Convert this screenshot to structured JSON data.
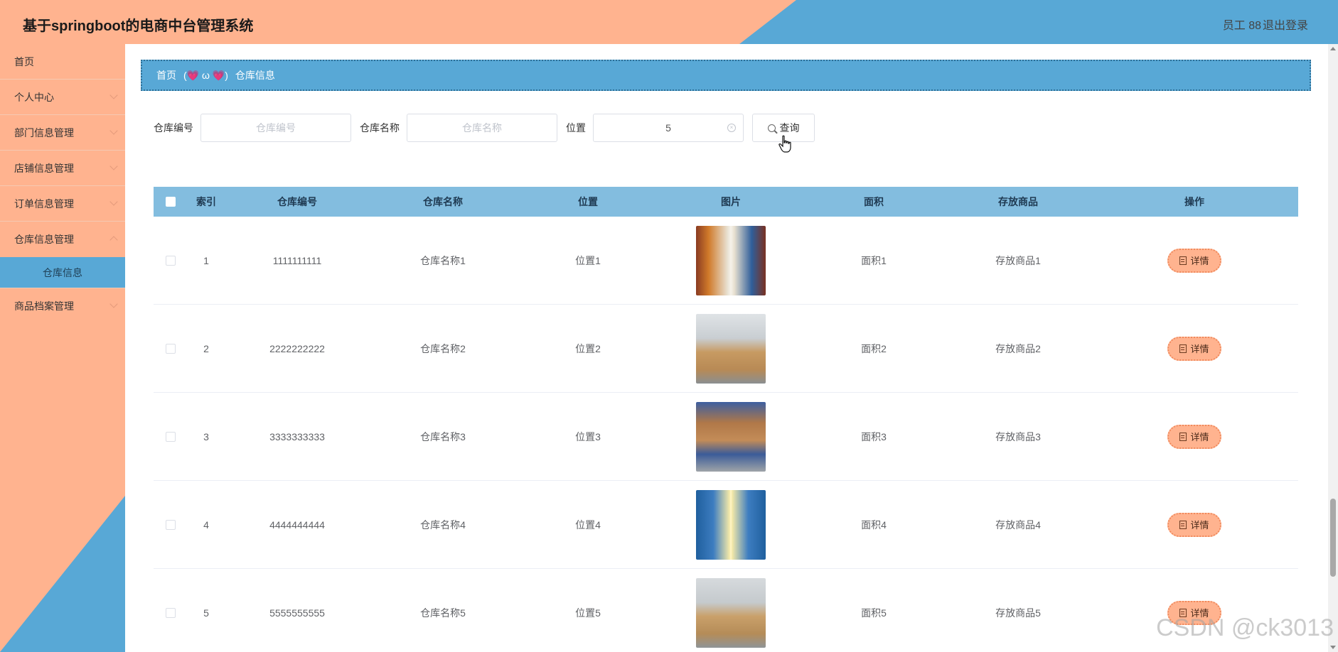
{
  "header": {
    "title": "基于springboot的电商中台管理系统",
    "user": "员工 88",
    "logout": "退出登录"
  },
  "sidebar": {
    "items": [
      {
        "label": "首页"
      },
      {
        "label": "个人中心"
      },
      {
        "label": "部门信息管理"
      },
      {
        "label": "店铺信息管理"
      },
      {
        "label": "订单信息管理"
      },
      {
        "label": "仓库信息管理"
      },
      {
        "label": "仓库信息"
      },
      {
        "label": "商品档案管理"
      }
    ]
  },
  "breadcrumb": {
    "home": "首页",
    "separator": "(💗 ω 💗)",
    "current": "仓库信息"
  },
  "search": {
    "code_label": "仓库编号",
    "code_placeholder": "仓库编号",
    "name_label": "仓库名称",
    "name_placeholder": "仓库名称",
    "pos_label": "位置",
    "pos_value": "5",
    "query_label": "查询"
  },
  "table": {
    "headers": [
      "索引",
      "仓库编号",
      "仓库名称",
      "位置",
      "图片",
      "面积",
      "存放商品",
      "操作"
    ],
    "rows": [
      {
        "idx": "1",
        "code": "1111111111",
        "name": "仓库名称1",
        "pos": "位置1",
        "area": "面积1",
        "goods": "存放商品1",
        "op": "详情"
      },
      {
        "idx": "2",
        "code": "2222222222",
        "name": "仓库名称2",
        "pos": "位置2",
        "area": "面积2",
        "goods": "存放商品2",
        "op": "详情"
      },
      {
        "idx": "3",
        "code": "3333333333",
        "name": "仓库名称3",
        "pos": "位置3",
        "area": "面积3",
        "goods": "存放商品3",
        "op": "详情"
      },
      {
        "idx": "4",
        "code": "4444444444",
        "name": "仓库名称4",
        "pos": "位置4",
        "area": "面积4",
        "goods": "存放商品4",
        "op": "详情"
      },
      {
        "idx": "5",
        "code": "5555555555",
        "name": "仓库名称5",
        "pos": "位置5",
        "area": "面积5",
        "goods": "存放商品5",
        "op": "详情"
      }
    ]
  },
  "watermark": "CSDN @ck3013",
  "colors": {
    "peach": "#ffb38f",
    "blue": "#58a8d6",
    "table_header": "#83bddf"
  }
}
